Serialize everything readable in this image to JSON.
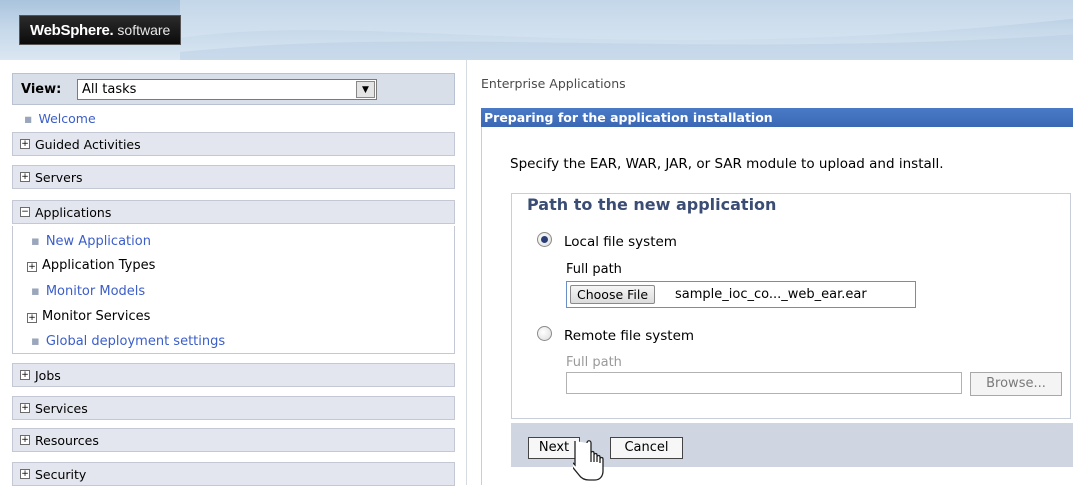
{
  "header": {
    "brand": "WebSphere.",
    "product": "software"
  },
  "nav": {
    "view_label": "View:",
    "view_value": "All tasks",
    "welcome": "Welcome",
    "categories": [
      {
        "label": "Guided Activities",
        "state": "+"
      },
      {
        "label": "Servers",
        "state": "+"
      },
      {
        "label": "Applications",
        "state": "−"
      },
      {
        "label": "Jobs",
        "state": "+"
      },
      {
        "label": "Services",
        "state": "+"
      },
      {
        "label": "Resources",
        "state": "+"
      },
      {
        "label": "Security",
        "state": "+"
      }
    ],
    "applications_items": [
      {
        "label": "New Application",
        "type": "link"
      },
      {
        "label": "Application Types",
        "type": "group"
      },
      {
        "label": "Monitor Models",
        "type": "link"
      },
      {
        "label": "Monitor Services",
        "type": "group"
      },
      {
        "label": "Global deployment settings",
        "type": "link"
      }
    ]
  },
  "main": {
    "breadcrumb": "Enterprise Applications",
    "panel_title": "Preparing for the application installation",
    "intro": "Specify the EAR, WAR, JAR, or SAR module to upload and install.",
    "fieldset_legend": "Path to the new application",
    "local": {
      "label": "Local file system",
      "full_path_label": "Full path",
      "choose_file_label": "Choose File",
      "file_name": "sample_ioc_co..._web_ear.ear",
      "selected": true
    },
    "remote": {
      "label": "Remote file system",
      "full_path_label": "Full path",
      "browse_label": "Browse...",
      "selected": false
    },
    "buttons": {
      "next": "Next",
      "cancel": "Cancel"
    }
  },
  "colors": {
    "title_bar": "#3a68b3",
    "link": "#3b5ec9",
    "header_bg": "#c4d7e9"
  }
}
